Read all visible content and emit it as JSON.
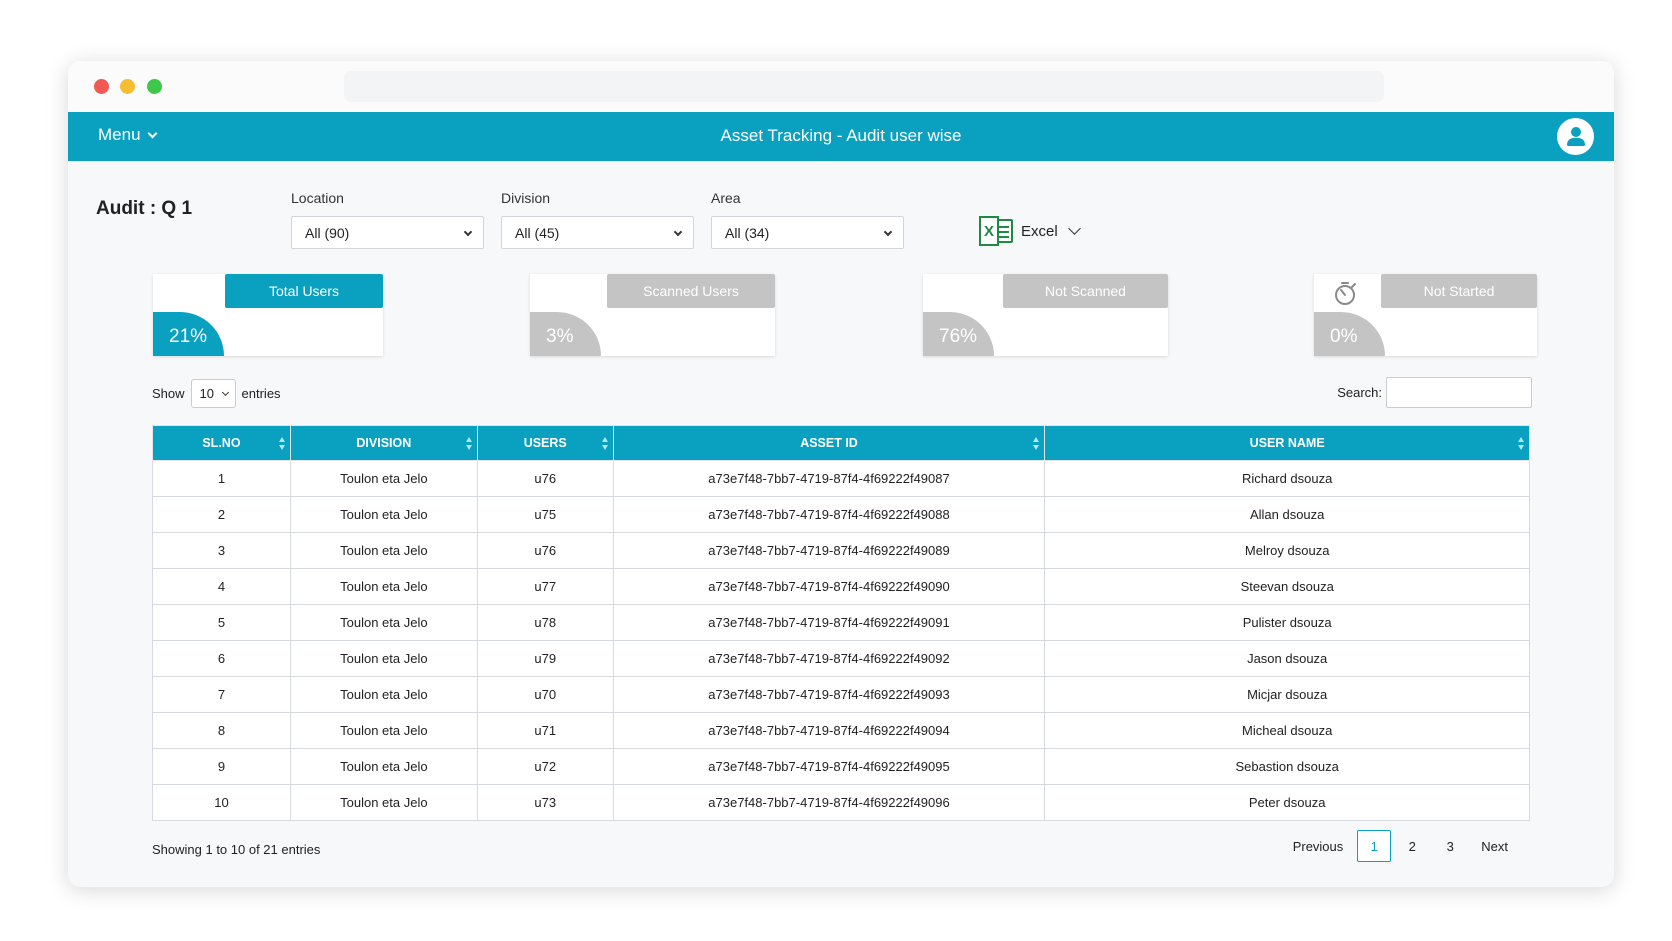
{
  "window": {
    "app_title": "Asset Tracking - Audit user wise",
    "menu_label": "Menu"
  },
  "audit": {
    "label": "Audit : Q 1"
  },
  "filters": [
    {
      "label": "Location",
      "value": "All (90)"
    },
    {
      "label": "Division",
      "value": "All (45)"
    },
    {
      "label": "Area",
      "value": "All (34)"
    }
  ],
  "export": {
    "label": "Excel"
  },
  "stats": [
    {
      "label": "Total Users",
      "percent": "21%",
      "color": "#0aa0bf"
    },
    {
      "label": "Scanned Users",
      "percent": "3%",
      "color": "#c4c4c4"
    },
    {
      "label": "Not Scanned",
      "percent": "76%",
      "color": "#c4c4c4"
    },
    {
      "label": "Not Started",
      "percent": "0%",
      "color": "#c4c4c4"
    }
  ],
  "table_controls": {
    "show_label": "Show",
    "entries_value": "10",
    "entries_label": "entries",
    "search_label": "Search:",
    "search_value": ""
  },
  "table": {
    "columns": [
      "SL.NO",
      "DIVISION",
      "USERS",
      "ASSET ID",
      "USER NAME"
    ],
    "rows": [
      [
        "1",
        "Toulon eta Jelo",
        "u76",
        "a73e7f48-7bb7-4719-87f4-4f69222f49087",
        "Richard dsouza"
      ],
      [
        "2",
        "Toulon eta Jelo",
        "u75",
        "a73e7f48-7bb7-4719-87f4-4f69222f49088",
        "Allan dsouza"
      ],
      [
        "3",
        "Toulon eta Jelo",
        "u76",
        "a73e7f48-7bb7-4719-87f4-4f69222f49089",
        "Melroy dsouza"
      ],
      [
        "4",
        "Toulon eta Jelo",
        "u77",
        "a73e7f48-7bb7-4719-87f4-4f69222f49090",
        "Steevan dsouza"
      ],
      [
        "5",
        "Toulon eta Jelo",
        "u78",
        "a73e7f48-7bb7-4719-87f4-4f69222f49091",
        "Pulister dsouza"
      ],
      [
        "6",
        "Toulon eta Jelo",
        "u79",
        "a73e7f48-7bb7-4719-87f4-4f69222f49092",
        "Jason dsouza"
      ],
      [
        "7",
        "Toulon eta Jelo",
        "u70",
        "a73e7f48-7bb7-4719-87f4-4f69222f49093",
        "Micjar dsouza"
      ],
      [
        "8",
        "Toulon eta Jelo",
        "u71",
        "a73e7f48-7bb7-4719-87f4-4f69222f49094",
        "Micheal dsouza"
      ],
      [
        "9",
        "Toulon eta Jelo",
        "u72",
        "a73e7f48-7bb7-4719-87f4-4f69222f49095",
        "Sebastion dsouza"
      ],
      [
        "10",
        "Toulon eta Jelo",
        "u73",
        "a73e7f48-7bb7-4719-87f4-4f69222f49096",
        "Peter dsouza"
      ]
    ]
  },
  "pagination": {
    "info": "Showing 1 to 10 of 21 entries",
    "previous": "Previous",
    "pages": [
      "1",
      "2",
      "3"
    ],
    "active_page": "1",
    "next": "Next"
  },
  "colors": {
    "brand": "#0aa0bf",
    "inactive": "#c4c4c4",
    "excel": "#1e8a43"
  },
  "icons": {
    "menu": "chevron-down-icon",
    "profile": "user-icon",
    "export": "excel-icon",
    "not_started": "timer-icon",
    "sort": "sort-icon"
  }
}
